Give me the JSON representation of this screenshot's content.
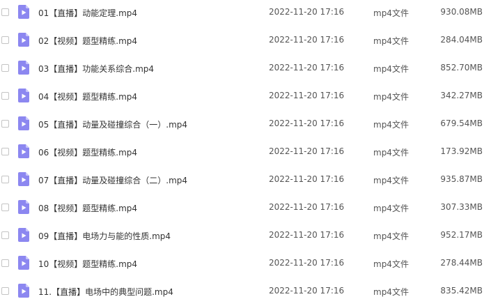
{
  "files": [
    {
      "name": "01【直播】动能定理.mp4",
      "date": "2022-11-20 17:16",
      "type": "mp4文件",
      "size": "930.08MB"
    },
    {
      "name": "02【视频】题型精练.mp4",
      "date": "2022-11-20 17:16",
      "type": "mp4文件",
      "size": "284.04MB"
    },
    {
      "name": "03【直播】功能关系综合.mp4",
      "date": "2022-11-20 17:16",
      "type": "mp4文件",
      "size": "852.70MB"
    },
    {
      "name": "04【视频】题型精练.mp4",
      "date": "2022-11-20 17:16",
      "type": "mp4文件",
      "size": "342.27MB"
    },
    {
      "name": "05【直播】动量及碰撞综合（一）.mp4",
      "date": "2022-11-20 17:16",
      "type": "mp4文件",
      "size": "679.54MB"
    },
    {
      "name": "06【视频】题型精练.mp4",
      "date": "2022-11-20 17:16",
      "type": "mp4文件",
      "size": "173.92MB"
    },
    {
      "name": "07【直播】动量及碰撞综合（二）.mp4",
      "date": "2022-11-20 17:16",
      "type": "mp4文件",
      "size": "935.87MB"
    },
    {
      "name": "08【视频】题型精练.mp4",
      "date": "2022-11-20 17:16",
      "type": "mp4文件",
      "size": "307.33MB"
    },
    {
      "name": "09【直播】电场力与能的性质.mp4",
      "date": "2022-11-20 17:16",
      "type": "mp4文件",
      "size": "952.17MB"
    },
    {
      "name": "10【视频】题型精练.mp4",
      "date": "2022-11-20 17:16",
      "type": "mp4文件",
      "size": "278.44MB"
    },
    {
      "name": "11.【直播】电场中的典型问题.mp4",
      "date": "2022-11-20 17:16",
      "type": "mp4文件",
      "size": "835.42MB"
    }
  ],
  "icon": {
    "name": "video-file-icon",
    "color": "#8c87f0",
    "fold_color": "#c9c6fb"
  }
}
